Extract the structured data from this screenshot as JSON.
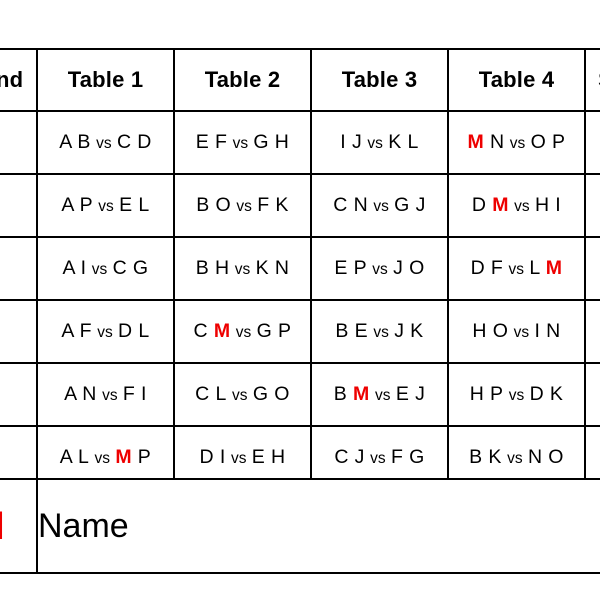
{
  "accent_color": "#ee0000",
  "text_color": "#000000",
  "background_color": "#ffffff",
  "schedule": {
    "headers": {
      "round": "Round",
      "tables": [
        "Table 1",
        "Table 2",
        "Table 3",
        "Table 4"
      ],
      "sit_out": "Sit"
    },
    "vs_label": "vs",
    "rows": [
      {
        "round": "",
        "sit_out": "",
        "matches": [
          {
            "left": "A B",
            "right": "C D",
            "mark": ""
          },
          {
            "left": "E F",
            "right": "G H",
            "mark": ""
          },
          {
            "left": "I J",
            "right": "K L",
            "mark": ""
          },
          {
            "left": "M N",
            "right": "O P",
            "mark": "left-first"
          }
        ]
      },
      {
        "round": "",
        "sit_out": "",
        "matches": [
          {
            "left": "A P",
            "right": "E L",
            "mark": ""
          },
          {
            "left": "B O",
            "right": "F K",
            "mark": ""
          },
          {
            "left": "C N",
            "right": "G J",
            "mark": ""
          },
          {
            "left": "D M",
            "right": "H I",
            "mark": "left-second"
          }
        ]
      },
      {
        "round": "",
        "sit_out": "",
        "matches": [
          {
            "left": "A I",
            "right": "C G",
            "mark": ""
          },
          {
            "left": "B H",
            "right": "K N",
            "mark": ""
          },
          {
            "left": "E P",
            "right": "J O",
            "mark": ""
          },
          {
            "left": "D F",
            "right": "L M",
            "mark": "right-second"
          }
        ]
      },
      {
        "round": "",
        "sit_out": "",
        "matches": [
          {
            "left": "A F",
            "right": "D L",
            "mark": ""
          },
          {
            "left": "C M",
            "right": "G P",
            "mark": "left-second"
          },
          {
            "left": "B E",
            "right": "J K",
            "mark": ""
          },
          {
            "left": "H O",
            "right": "I N",
            "mark": ""
          }
        ]
      },
      {
        "round": "",
        "sit_out": "",
        "matches": [
          {
            "left": "A N",
            "right": "F I",
            "mark": ""
          },
          {
            "left": "C L",
            "right": "G O",
            "mark": ""
          },
          {
            "left": "B M",
            "right": "E J",
            "mark": "left-second"
          },
          {
            "left": "H P",
            "right": "D K",
            "mark": ""
          }
        ]
      },
      {
        "round": "",
        "sit_out": "",
        "matches": [
          {
            "left": "A L",
            "right": "M P",
            "mark": "right-first"
          },
          {
            "left": "D I",
            "right": "E H",
            "mark": ""
          },
          {
            "left": "C J",
            "right": "F G",
            "mark": ""
          },
          {
            "left": "B K",
            "right": "N O",
            "mark": ""
          }
        ]
      }
    ]
  },
  "legend": {
    "key": "M",
    "value": "Name"
  }
}
